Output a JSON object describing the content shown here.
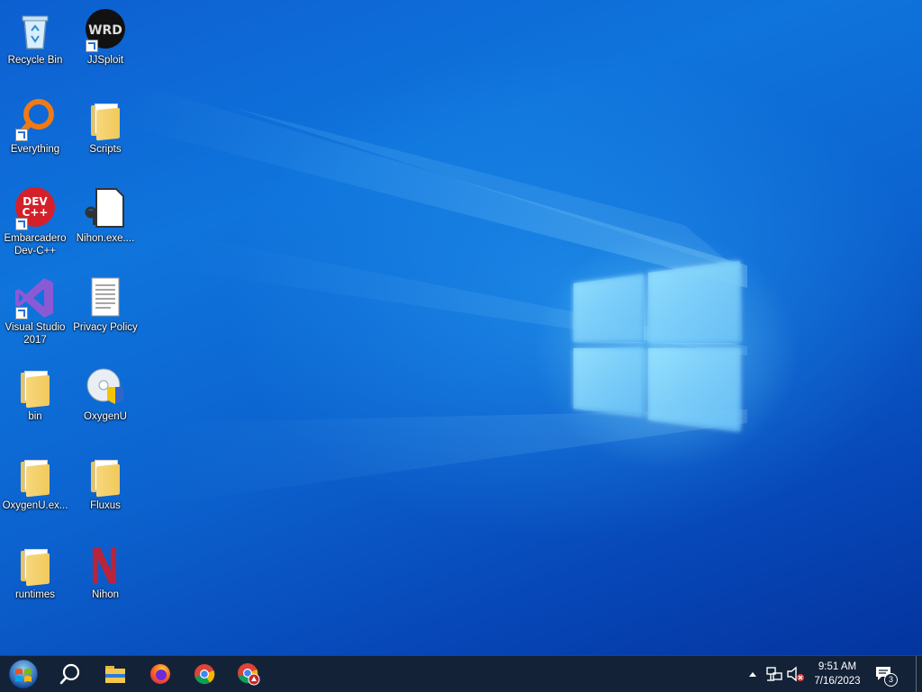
{
  "desktop": {
    "icons": [
      {
        "label": "Recycle Bin",
        "icon": "recycle-bin-icon"
      },
      {
        "label": "JJSploit",
        "icon": "jjsploit-icon"
      },
      {
        "label": "Everything",
        "icon": "everything-search-icon"
      },
      {
        "label": "Scripts",
        "icon": "folder-icon"
      },
      {
        "label": "Embarcadero Dev-C++",
        "icon": "devcpp-icon",
        "logo_text": "DEV C++"
      },
      {
        "label": "Nihon.exe....",
        "icon": "exe-file-icon"
      },
      {
        "label": "Visual Studio 2017",
        "icon": "visual-studio-icon"
      },
      {
        "label": "Privacy Policy",
        "icon": "text-document-icon"
      },
      {
        "label": "bin",
        "icon": "folder-icon"
      },
      {
        "label": "OxygenU",
        "icon": "installer-disc-icon"
      },
      {
        "label": "OxygenU.ex...",
        "icon": "folder-icon"
      },
      {
        "label": "Fluxus",
        "icon": "folder-icon"
      },
      {
        "label": "runtimes",
        "icon": "folder-icon"
      },
      {
        "label": "Nihon",
        "icon": "nihon-app-icon"
      }
    ]
  },
  "taskbar": {
    "start": "start-orb-icon",
    "pinned": [
      "search-icon",
      "file-explorer-icon",
      "firefox-icon",
      "chrome-icon",
      "chrome-warning-icon"
    ],
    "tray": {
      "chevron": "show-hidden-icons",
      "network": "network-icon",
      "volume": "volume-muted-icon",
      "time": "9:51 AM",
      "date": "7/16/2023",
      "notifications_count": "3"
    }
  }
}
